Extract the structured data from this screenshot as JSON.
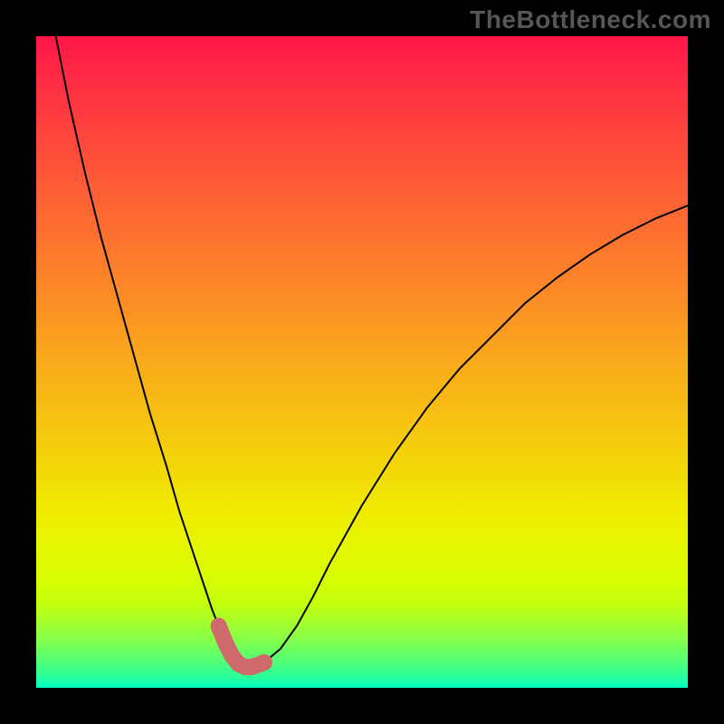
{
  "watermark": "TheBottleneck.com",
  "colors": {
    "page_bg": "#000000",
    "curve_main": "#000000",
    "curve_highlight": "#CE6A6C",
    "gradient_stops": [
      {
        "offset": 0.0,
        "color": "#FF1649"
      },
      {
        "offset": 0.12,
        "color": "#FF3C3F"
      },
      {
        "offset": 0.25,
        "color": "#FE6234"
      },
      {
        "offset": 0.38,
        "color": "#FC8628"
      },
      {
        "offset": 0.5,
        "color": "#F9AA1B"
      },
      {
        "offset": 0.62,
        "color": "#F4CB0D"
      },
      {
        "offset": 0.73,
        "color": "#EFEB00"
      },
      {
        "offset": 0.78,
        "color": "#E6F700"
      },
      {
        "offset": 0.83,
        "color": "#D9FC00"
      },
      {
        "offset": 0.87,
        "color": "#C3FF0D"
      },
      {
        "offset": 0.9,
        "color": "#A6FF2B"
      },
      {
        "offset": 0.93,
        "color": "#7FFF4F"
      },
      {
        "offset": 0.96,
        "color": "#52FF77"
      },
      {
        "offset": 0.985,
        "color": "#26FF9F"
      },
      {
        "offset": 1.0,
        "color": "#00FFC3"
      }
    ]
  },
  "chart_data": {
    "type": "line",
    "title": "",
    "xlabel": "",
    "ylabel": "",
    "xlim": [
      0,
      100
    ],
    "ylim": [
      0,
      100
    ],
    "series": [
      {
        "name": "bottleneck-curve",
        "x": [
          3,
          5,
          7.5,
          10,
          12.5,
          15,
          17.5,
          20,
          22,
          24,
          26,
          27,
          28,
          29,
          30,
          31,
          32,
          33,
          35,
          37.5,
          40,
          42.5,
          45,
          50,
          55,
          60,
          65,
          70,
          75,
          80,
          85,
          90,
          95,
          100
        ],
        "y": [
          100,
          90,
          79,
          69,
          60,
          51,
          42,
          34,
          27,
          21,
          15,
          12,
          9.5,
          7,
          5,
          3.7,
          3.2,
          3.2,
          3.9,
          6,
          9.5,
          14,
          19,
          28,
          36,
          43,
          49,
          54,
          59,
          63,
          66.5,
          69.5,
          72,
          74
        ]
      },
      {
        "name": "highlight-segment",
        "x": [
          28,
          29,
          30,
          31,
          32,
          33,
          34,
          35
        ],
        "y": [
          9.5,
          7,
          5,
          3.7,
          3.2,
          3.2,
          3.5,
          3.9
        ]
      }
    ]
  }
}
